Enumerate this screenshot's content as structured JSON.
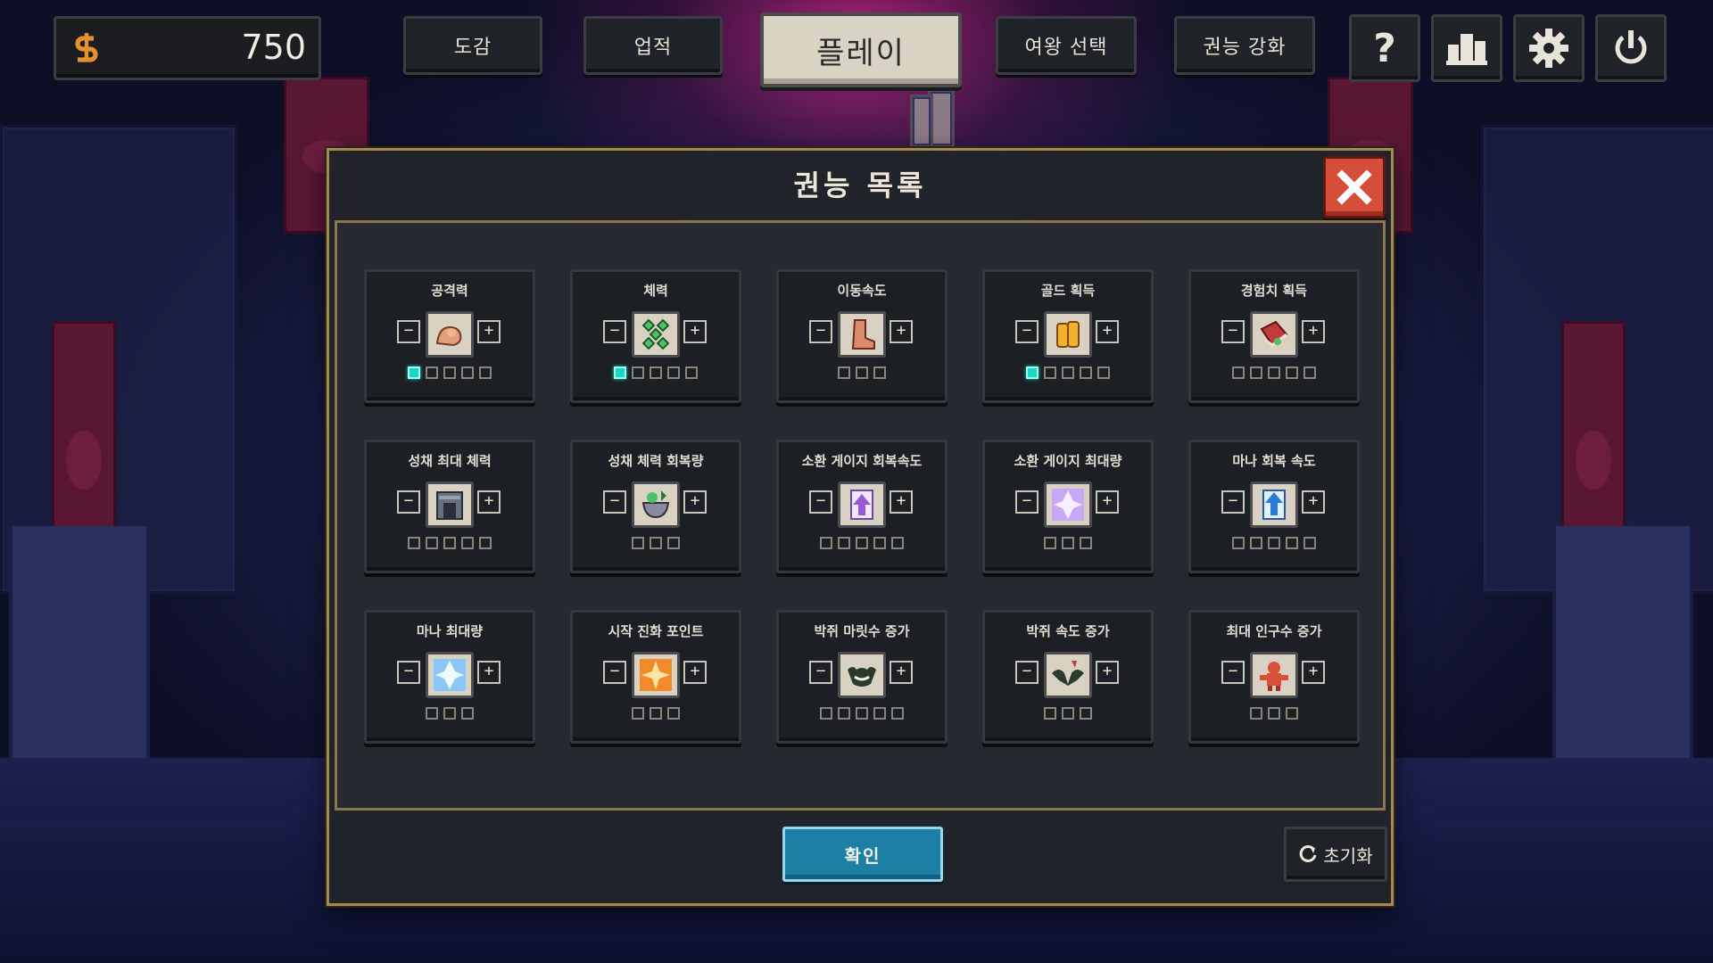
{
  "topbar": {
    "gold": "750",
    "buttons": {
      "codex": "도감",
      "achievements": "업적",
      "play": "플레이",
      "queen_select": "여왕 선택",
      "power_upgrade": "권능 강화"
    },
    "icons": [
      "help-icon",
      "ranking-icon",
      "settings-icon",
      "power-off-icon"
    ]
  },
  "modal": {
    "title": "권능 목록",
    "confirm_label": "확인",
    "reset_label": "초기화"
  },
  "skills": [
    {
      "label": "공격력",
      "icon": "muscle-icon",
      "max": 5,
      "level": 1
    },
    {
      "label": "체력",
      "icon": "green-gems-icon",
      "max": 5,
      "level": 1
    },
    {
      "label": "이동속도",
      "icon": "boot-icon",
      "max": 3,
      "level": 0
    },
    {
      "label": "골드 획득",
      "icon": "gold-coins-icon",
      "max": 5,
      "level": 1
    },
    {
      "label": "경험치 획득",
      "icon": "red-book-icon",
      "max": 5,
      "level": 0
    },
    {
      "label": "성채 최대 체력",
      "icon": "castle-gate-icon",
      "max": 5,
      "level": 0
    },
    {
      "label": "성채 체력 회복량",
      "icon": "potion-bowl-icon",
      "max": 3,
      "level": 0
    },
    {
      "label": "소환 게이지 회복속도",
      "icon": "purple-arrow-up-icon",
      "max": 5,
      "level": 0
    },
    {
      "label": "소환 게이지 최대량",
      "icon": "purple-crystal-icon",
      "max": 3,
      "level": 0
    },
    {
      "label": "마나 회복 속도",
      "icon": "blue-arrow-up-icon",
      "max": 5,
      "level": 0
    },
    {
      "label": "마나 최대량",
      "icon": "blue-crystal-icon",
      "max": 3,
      "level": 0
    },
    {
      "label": "시작 진화 포인트",
      "icon": "orange-burst-icon",
      "max": 3,
      "level": 0
    },
    {
      "label": "박쥐 마릿수 증가",
      "icon": "bat-smile-icon",
      "max": 5,
      "level": 0
    },
    {
      "label": "박쥐 속도 증가",
      "icon": "bat-speed-icon",
      "max": 3,
      "level": 0
    },
    {
      "label": "최대 인구수 증가",
      "icon": "red-imp-icon",
      "max": 3,
      "level": 0
    }
  ],
  "colors": {
    "pip_active": "#1dd5c4",
    "confirm": "#1d7fa6",
    "close": "#d64d3a",
    "modal_border": "#a48a52"
  }
}
